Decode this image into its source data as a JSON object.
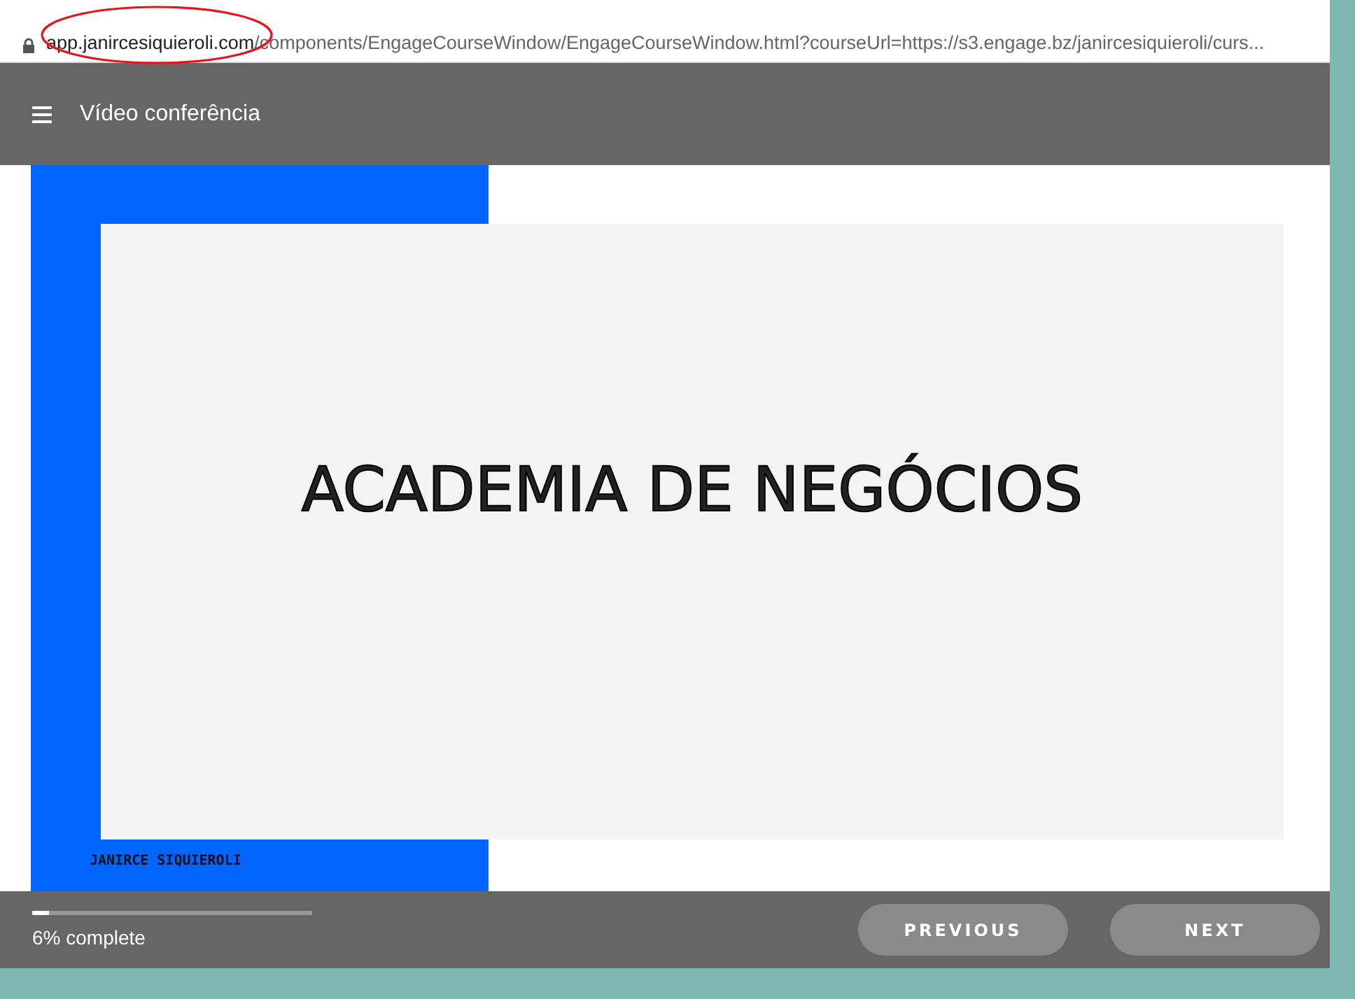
{
  "address_bar": {
    "url_host": "app.janircesiquieroli.com",
    "url_path": "/components/EngageCourseWindow/EngageCourseWindow.html?courseUrl=https://s3.engage.bz/janircesiquieroli/curs..."
  },
  "header": {
    "title": "Vídeo conferência"
  },
  "slide": {
    "title": "ACADEMIA DE NEGÓCIOS",
    "author": "JANIRCE SIQUIEROLI"
  },
  "footer": {
    "progress": {
      "level": 0.06,
      "label": "6% complete"
    },
    "buttons": [
      "PREVIOUS",
      "NEXT"
    ]
  }
}
